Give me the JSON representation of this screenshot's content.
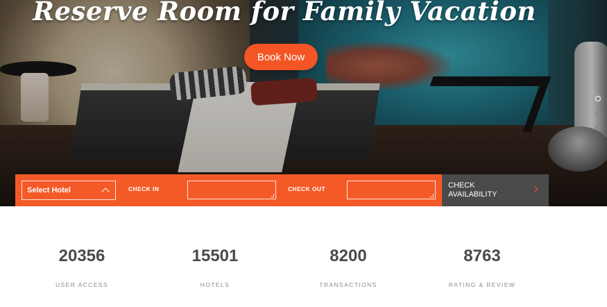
{
  "hero": {
    "headline": "Reserve Room for Family Vacation",
    "cta_label": "Book Now",
    "slider_dots": 3,
    "active_dot": 0
  },
  "booking": {
    "select_hotel": "Select Hotel",
    "check_in_label": "CHECK IN",
    "check_in_value": "",
    "check_out_label": "CHECK OUT",
    "check_out_value": "",
    "check_availability_line1": "CHECK",
    "check_availability_line2": "AVAILABILITY"
  },
  "stats": [
    {
      "value": "20356",
      "caption": "USER ACCESS"
    },
    {
      "value": "15501",
      "caption": "HOTELS"
    },
    {
      "value": "8200",
      "caption": "TRANSACTIONS"
    },
    {
      "value": "8763",
      "caption": "RATING & REVIEW"
    }
  ],
  "colors": {
    "accent": "#f45a27",
    "button": "#f35525",
    "dark_button": "#4a4a4a",
    "stat_number": "#4a4a4a",
    "stat_caption": "#8a8a8a"
  },
  "icons": {
    "select_chevron": "chevron-up-icon",
    "check_availability_arrow": "chevron-right-icon",
    "input_resize": "resize-grip-icon"
  }
}
